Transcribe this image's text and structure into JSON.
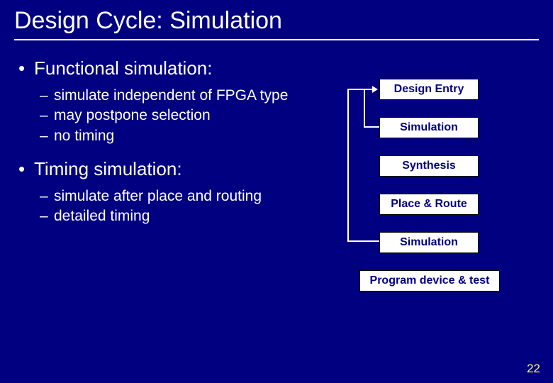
{
  "title": "Design Cycle: Simulation",
  "sections": [
    {
      "heading": "Functional simulation:",
      "items": [
        "simulate independent of FPGA type",
        "may postpone selection",
        "no timing"
      ]
    },
    {
      "heading": "Timing simulation:",
      "items": [
        "simulate after place and routing",
        "detailed timing"
      ]
    }
  ],
  "diagram": {
    "boxes": [
      "Design Entry",
      "Simulation",
      "Synthesis",
      "Place & Route",
      "Simulation",
      "Program device & test"
    ]
  },
  "page_number": "22"
}
